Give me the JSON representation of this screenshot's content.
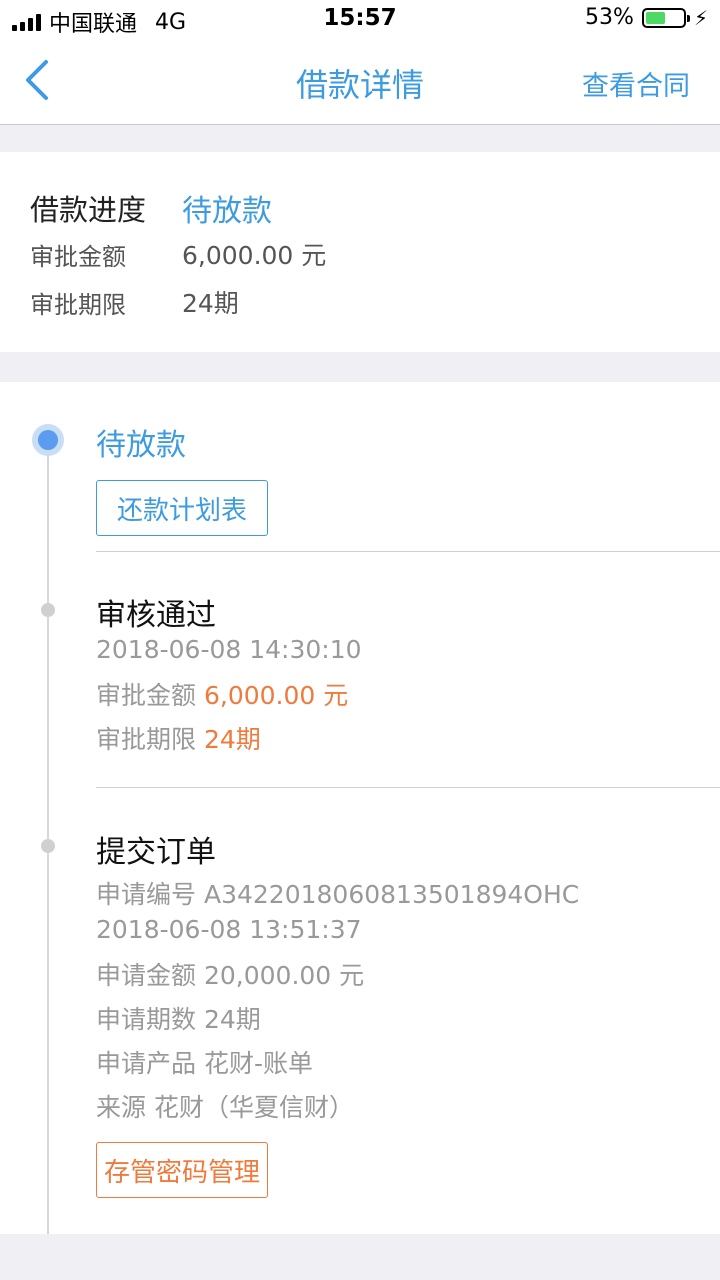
{
  "status_bar": {
    "carrier": "中国联通",
    "network": "4G",
    "time": "15:57",
    "battery_percent": "53%",
    "battery_level": 0.53,
    "battery_color": "#4cd964"
  },
  "nav": {
    "back_icon": "chevron-left-icon",
    "title": "借款详情",
    "action": "查看合同",
    "accent_color": "#3d9be0"
  },
  "summary": {
    "progress_label": "借款进度",
    "progress_value": "待放款",
    "amount_label": "审批金额",
    "amount_value": "6,000.00 元",
    "term_label": "审批期限",
    "term_value": "24期"
  },
  "timeline": {
    "current": {
      "status": "待放款",
      "button": "还款计划表"
    },
    "approved": {
      "title": "审核通过",
      "time": "2018-06-08 14:30:10",
      "amount_label": "审批金额",
      "amount_value": "6,000.00 元",
      "term_label": "审批期限",
      "term_value": "24期"
    },
    "submitted": {
      "title": "提交订单",
      "app_no_label": "申请编号",
      "app_no_value": "A3422018060813501894OHC",
      "time": "2018-06-08 13:51:37",
      "amount_label": "申请金额",
      "amount_value": "20,000.00 元",
      "periods_label": "申请期数",
      "periods_value": "24期",
      "product_label": "申请产品",
      "product_value": "花财-账单",
      "source_label": "来源",
      "source_value": "花财（华夏信财）",
      "button": "存管密码管理"
    },
    "highlight_color": "#f07a3c"
  }
}
